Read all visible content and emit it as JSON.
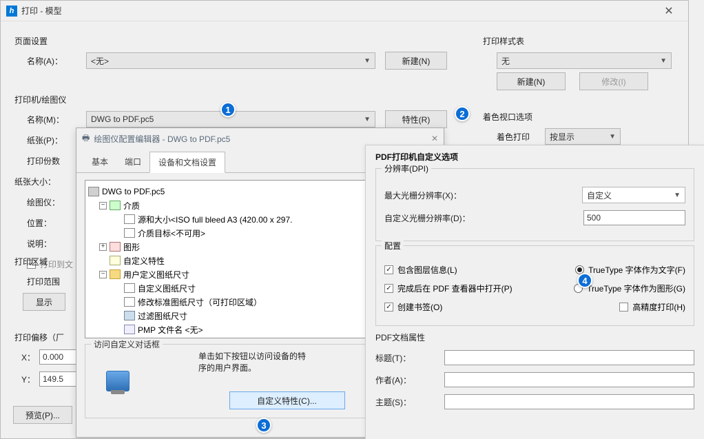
{
  "main": {
    "title": "打印 - 模型",
    "pageSetup": {
      "legend": "页面设置",
      "nameLabel": "名称(A)：",
      "nameValue": "<无>",
      "newBtn": "新建(N)"
    },
    "styleTable": {
      "legend": "打印样式表",
      "value": "无",
      "newBtn": "新建(N)",
      "modifyBtn": "修改(I)"
    },
    "printer": {
      "legend": "打印机/绘图仪",
      "nameLabel": "名称(M)：",
      "nameValue": "DWG to PDF.pc5",
      "propsBtn": "特性(R)",
      "paperLabel": "纸张(P)：",
      "copiesLabel": "打印份数",
      "paperSizeLabel": "纸张大小：",
      "plotterLabel": "绘图仪：",
      "locationLabel": "位置：",
      "descLabel": "说明：",
      "toFileChk": "打印到文"
    },
    "viewport": {
      "legend": "着色视口选项",
      "shadeLabel": "着色打印",
      "shadeValue": "按显示"
    },
    "area": {
      "legend": "打印区域",
      "rangeLabel": "打印范围",
      "showBtn": "显示"
    },
    "offset": {
      "legend": "打印偏移（厂",
      "xLabel": "X：",
      "xValue": "0.000",
      "yLabel": "Y：",
      "yValue": "149.5"
    },
    "previewBtn": "预览(P)..."
  },
  "cfg": {
    "title": "绘图仪配置编辑器 - DWG to PDF.pc5",
    "tabs": {
      "t1": "基本",
      "t2": "端口",
      "t3": "设备和文档设置"
    },
    "tree": {
      "root": "DWG to PDF.pc5",
      "media": "介质",
      "srcSize": "源和大小<ISO full bleed A3 (420.00 x 297.",
      "dest": "介质目标<不可用>",
      "graphics": "图形",
      "custom": "自定义特性",
      "userPaper": "用户定义图纸尺寸",
      "customPaper": "自定义图纸尺寸",
      "modStd": "修改标准图纸尺寸（可打印区域）",
      "filter": "过滤图纸尺寸",
      "pmp": "PMP 文件名 <无>"
    },
    "access": {
      "legend": "访问自定义对话框",
      "hint1": "单击如下按钮以访问设备的特",
      "hint2": "序的用户界面。",
      "btn": "自定义特性(C)..."
    }
  },
  "pdf": {
    "title": "PDF打印机自定义选项",
    "dpi": {
      "legend": "分辨率(DPI)",
      "maxLabel": "最大光栅分辨率(X)：",
      "maxValue": "自定义",
      "customLabel": "自定义光栅分辨率(D)：",
      "customValue": "500"
    },
    "config": {
      "legend": "配置",
      "layers": "包含图层信息(L)",
      "openAfter": "完成后在 PDF 查看器中打开(P)",
      "bookmarks": "创建书签(O)",
      "ttText": "TrueType 字体作为文字(F)",
      "ttGeom": "TrueType 字体作为图形(G)",
      "hiPrec": "高精度打印(H)"
    },
    "doc": {
      "legend": "PDF文档属性",
      "titleLabel": "标题(T)：",
      "authorLabel": "作者(A)：",
      "subjectLabel": "主题(S)："
    }
  },
  "badges": {
    "b1": "1",
    "b2": "2",
    "b3": "3",
    "b4": "4"
  }
}
